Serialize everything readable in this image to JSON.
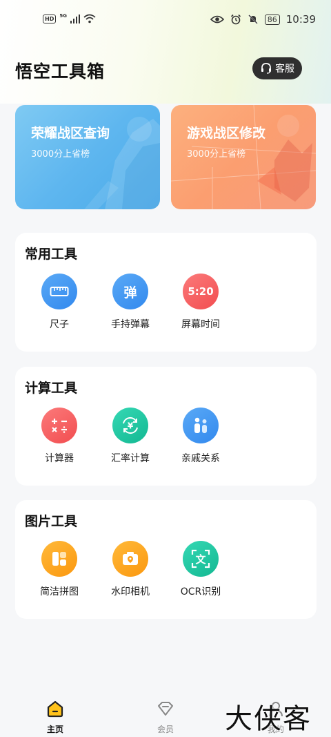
{
  "status_bar": {
    "hd": "HD",
    "network": "5G",
    "battery": "86",
    "time": "10:39"
  },
  "header": {
    "title": "悟空工具箱",
    "service_label": "客服"
  },
  "banners": [
    {
      "title": "荣耀战区查询",
      "subtitle": "3000分上省榜"
    },
    {
      "title": "游戏战区修改",
      "subtitle": "3000分上省榜"
    }
  ],
  "sections": [
    {
      "title": "常用工具",
      "tools": [
        {
          "label": "尺子",
          "icon": "ruler-icon"
        },
        {
          "label": "手持弹幕",
          "icon": "danmu-icon",
          "glyph": "弹"
        },
        {
          "label": "屏幕时间",
          "icon": "clock-icon",
          "glyph": "5:20"
        }
      ]
    },
    {
      "title": "计算工具",
      "tools": [
        {
          "label": "计算器",
          "icon": "calculator-icon"
        },
        {
          "label": "汇率计算",
          "icon": "currency-exchange-icon"
        },
        {
          "label": "亲戚关系",
          "icon": "relatives-icon"
        }
      ]
    },
    {
      "title": "图片工具",
      "tools": [
        {
          "label": "简洁拼图",
          "icon": "collage-icon"
        },
        {
          "label": "水印相机",
          "icon": "camera-icon"
        },
        {
          "label": "OCR识别",
          "icon": "ocr-icon",
          "glyph": "文"
        }
      ]
    }
  ],
  "bottom_nav": [
    {
      "label": "主页",
      "icon": "home-icon",
      "active": true
    },
    {
      "label": "会员",
      "icon": "diamond-icon",
      "active": false
    },
    {
      "label": "我的",
      "icon": "profile-icon",
      "active": false
    }
  ],
  "watermark": "大侠客",
  "colors": {
    "blue": "#3d8ff0",
    "red": "#f6575a",
    "teal": "#1cc3a0",
    "orange": "#fba01a",
    "dark_button": "#2f2f2f"
  }
}
